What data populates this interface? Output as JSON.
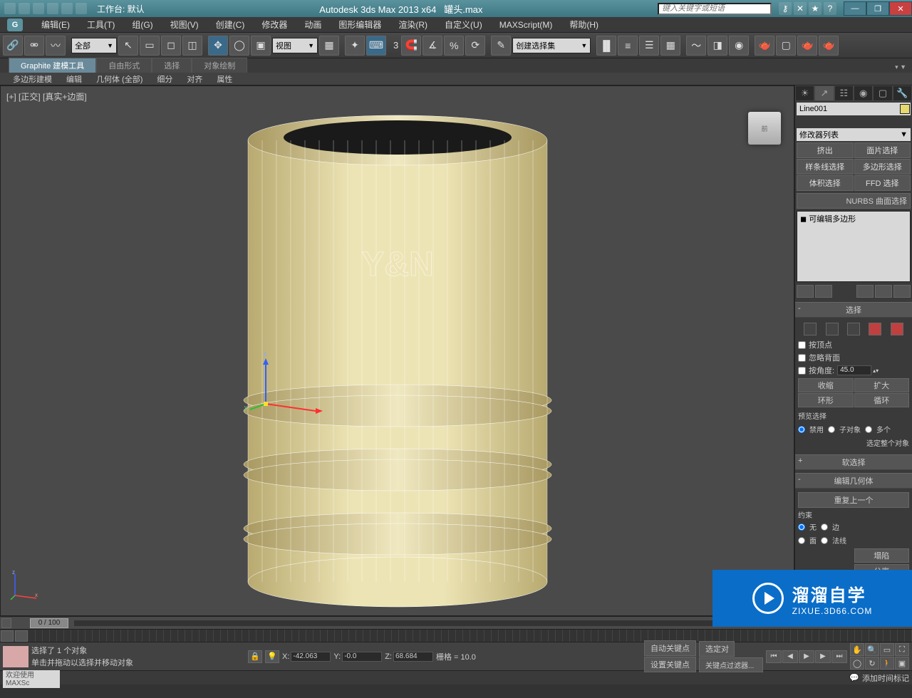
{
  "title": {
    "workspace_label": "工作台: 默认",
    "app": "Autodesk 3ds Max  2013 x64",
    "file": "罐头.max",
    "search_placeholder": "键入关键字或短语"
  },
  "menu": {
    "items": [
      "编辑(E)",
      "工具(T)",
      "组(G)",
      "视图(V)",
      "创建(C)",
      "修改器",
      "动画",
      "图形编辑器",
      "渲染(R)",
      "自定义(U)",
      "MAXScript(M)",
      "帮助(H)"
    ]
  },
  "maintoolbar": {
    "allCombo": "全部",
    "viewCombo": "视图",
    "angLabel": "3",
    "selSetCombo": "创建选择集"
  },
  "ribbon": {
    "tabs": [
      "Graphite 建模工具",
      "自由形式",
      "选择",
      "对象绘制"
    ],
    "activeTab": 0,
    "subs": [
      "多边形建模",
      "编辑",
      "几何体 (全部)",
      "细分",
      "对齐",
      "属性"
    ]
  },
  "viewport": {
    "label": "[+] [正交] [真实+边面]",
    "cube": "前",
    "bodyText": "Y&N"
  },
  "cmd": {
    "objname": "Line001",
    "modlistHdr": "修改器列表",
    "shapeBtns": [
      "挤出",
      "面片选择",
      "样条线选择",
      "多边形选择",
      "体积选择",
      "FFD 选择"
    ],
    "nurbs": "NURBS 曲面选择",
    "stackItem": "可编辑多边形",
    "rollouts": {
      "sel": {
        "hdr": "选择",
        "byVertex": "按顶点",
        "ignoreBack": "忽略背面",
        "byAngle": "按角度:",
        "angleVal": "45.0",
        "shrink": "收缩",
        "grow": "扩大",
        "ring": "环形",
        "loop": "循环",
        "previewLbl": "预览选择",
        "disable": "禁用",
        "subobj": "子对象",
        "multi": "多个",
        "wholeObj": "选定整个对象"
      },
      "softSel": "软选择",
      "editGeom": "编辑几何体",
      "repeat": "重复上一个",
      "constrain": {
        "label": "约束",
        "none": "无",
        "edge": "边",
        "face": "面",
        "normal": "法线"
      },
      "collapse": "塌陷",
      "detach": "分离"
    }
  },
  "timeline": {
    "frame": "0 / 100"
  },
  "status": {
    "prompt1": "选择了 1 个对象",
    "prompt2": "单击并拖动以选择并移动对象",
    "x": "-42.063",
    "y": "-0.0",
    "z": "68.684",
    "grid": "栅格 = 10.0",
    "addTime": "添加时间标记",
    "autoKey": "自动关键点",
    "setKey": "设置关键点",
    "selLock": "选定对",
    "keyFilter": "关键点过滤器..."
  },
  "status2": {
    "welcome": "欢迎使用  MAXSc"
  },
  "watermark": {
    "big": "溜溜自学",
    "small": "ZIXUE.3D66.COM"
  }
}
